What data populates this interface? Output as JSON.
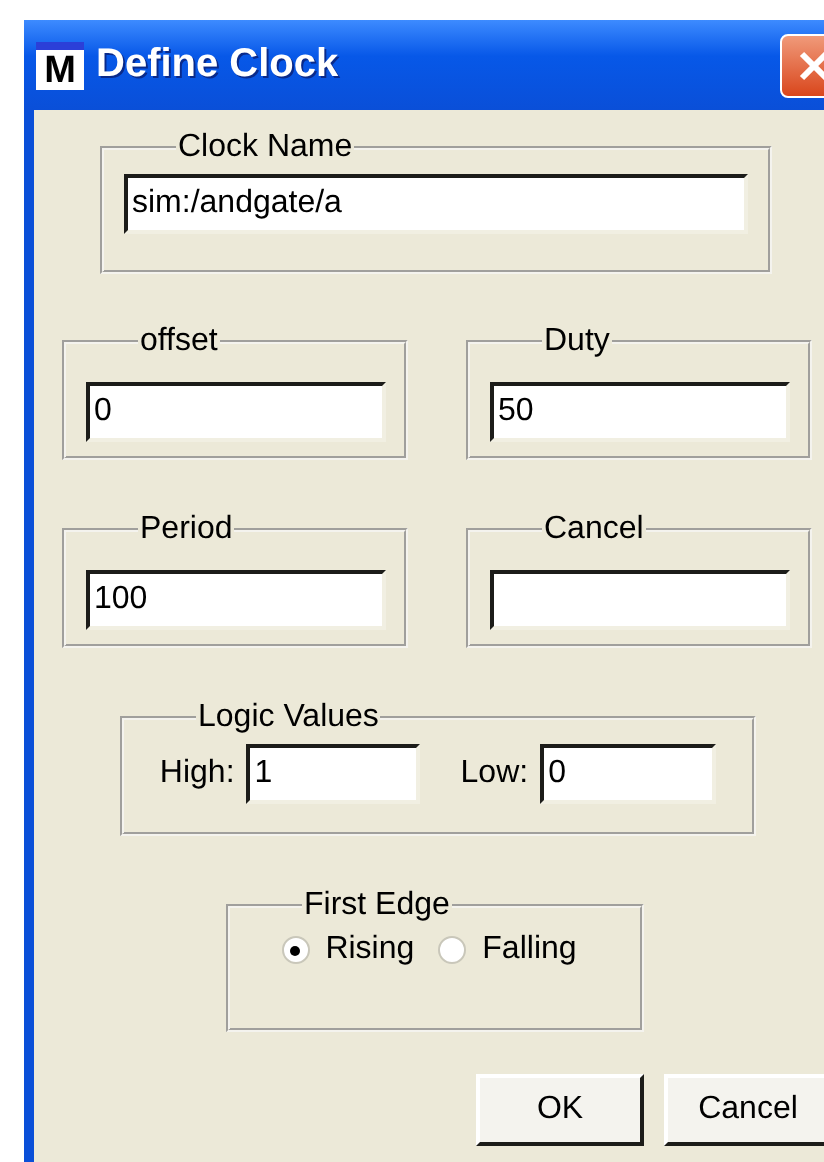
{
  "window": {
    "title": "Define Clock",
    "icon_letter": "M"
  },
  "clock_name": {
    "label": "Clock Name",
    "value": "sim:/andgate/a"
  },
  "fields": [
    {
      "label": "offset",
      "value": "0"
    },
    {
      "label": "Duty",
      "value": "50"
    },
    {
      "label": "Period",
      "value": "100"
    },
    {
      "label": "Cancel"
    }
  ],
  "logic_values": {
    "label": "Logic Values",
    "high": {
      "label": "High:",
      "value": "1"
    },
    "low": {
      "label": "Low:",
      "value": "0"
    }
  },
  "first_edge": {
    "label": "First Edge",
    "options": [
      {
        "label": "Rising",
        "selected": true
      },
      {
        "label": "Falling",
        "selected": false
      }
    ]
  },
  "buttons": [
    "OK",
    "Cancel"
  ]
}
